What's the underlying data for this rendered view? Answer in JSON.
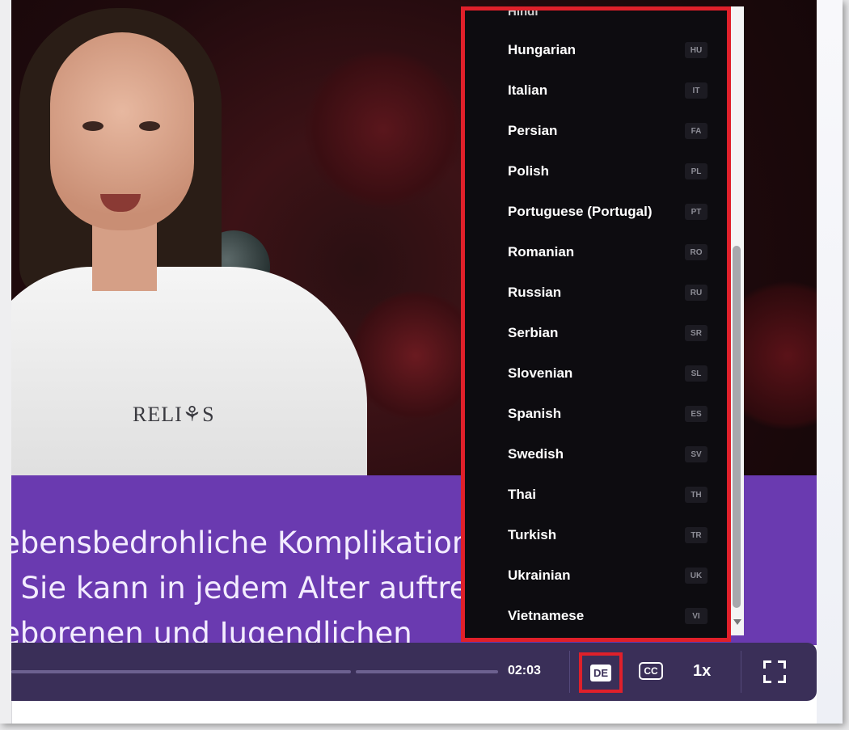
{
  "video": {
    "shirt_logo": "RELI⚘S"
  },
  "captions": {
    "line1": "ebensbedrohliche Komplikation",
    "line2": ". Sie kann in jedem Alter auftreten,",
    "line3": "eborenen und Jugendlichen"
  },
  "controls": {
    "time": "02:03",
    "language_code": "DE",
    "cc_label": "CC",
    "speed": "1x",
    "icons": [
      "fullscreen-icon"
    ]
  },
  "language_menu": {
    "partial_top": "Hindi",
    "items": [
      {
        "label": "Hungarian",
        "code": "HU"
      },
      {
        "label": "Italian",
        "code": "IT"
      },
      {
        "label": "Persian",
        "code": "FA"
      },
      {
        "label": "Polish",
        "code": "PL"
      },
      {
        "label": "Portuguese (Portugal)",
        "code": "PT"
      },
      {
        "label": "Romanian",
        "code": "RO"
      },
      {
        "label": "Russian",
        "code": "RU"
      },
      {
        "label": "Serbian",
        "code": "SR"
      },
      {
        "label": "Slovenian",
        "code": "SL"
      },
      {
        "label": "Spanish",
        "code": "ES"
      },
      {
        "label": "Swedish",
        "code": "SV"
      },
      {
        "label": "Thai",
        "code": "TH"
      },
      {
        "label": "Turkish",
        "code": "TR"
      },
      {
        "label": "Ukrainian",
        "code": "UK"
      },
      {
        "label": "Vietnamese",
        "code": "VI"
      }
    ]
  },
  "colors": {
    "highlight": "#e0202a",
    "caption_bg": "#6a3ab0",
    "controls_bg": "#3a2f58"
  }
}
